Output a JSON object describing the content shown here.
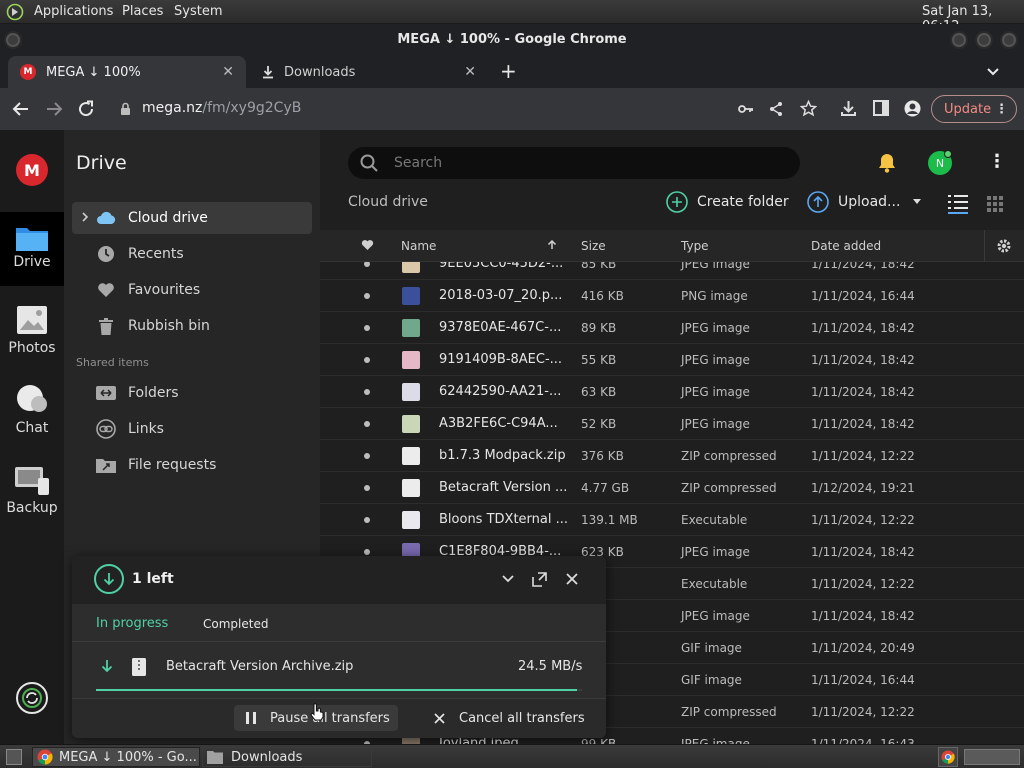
{
  "panel": {
    "applications": "Applications",
    "places": "Places",
    "system": "System",
    "clock": "Sat Jan 13, 06:12"
  },
  "window": {
    "title": "MEGA ↓ 100% - Google Chrome"
  },
  "tabs": [
    {
      "label": "MEGA ↓ 100%",
      "close": "✕"
    },
    {
      "label": "Downloads",
      "close": "✕"
    }
  ],
  "toolbar": {
    "url_host": "mega.nz",
    "url_path": "/fm/xy9g2CyB",
    "update_label": "Update"
  },
  "rail": {
    "items": [
      {
        "label": "Drive"
      },
      {
        "label": "Photos"
      },
      {
        "label": "Chat"
      },
      {
        "label": "Backup"
      }
    ]
  },
  "sidebar": {
    "title": "Drive",
    "items": [
      {
        "label": "Cloud drive"
      },
      {
        "label": "Recents"
      },
      {
        "label": "Favourites"
      },
      {
        "label": "Rubbish bin"
      }
    ],
    "shared_header": "Shared items",
    "shared": [
      {
        "label": "Folders"
      },
      {
        "label": "Links"
      },
      {
        "label": "File requests"
      }
    ]
  },
  "main": {
    "search_placeholder": "Search",
    "avatar": "N",
    "breadcrumb": "Cloud drive",
    "create_folder": "Create folder",
    "upload": "Upload...",
    "columns": {
      "name": "Name",
      "size": "Size",
      "type": "Type",
      "date": "Date added"
    },
    "rows": [
      {
        "name": "9ΕE05CC0-45D2-...",
        "size": "85 KB",
        "type": "JPEG image",
        "date": "1/11/2024, 18:42",
        "color": "#d9c9a8"
      },
      {
        "name": "2018-03-07_20.p...",
        "size": "416 KB",
        "type": "PNG image",
        "date": "1/11/2024, 16:44",
        "color": "#3c4f9a"
      },
      {
        "name": "9378E0AE-467C-...",
        "size": "89 KB",
        "type": "JPEG image",
        "date": "1/11/2024, 18:42",
        "color": "#6fa88a"
      },
      {
        "name": "9191409B-8AEC-...",
        "size": "55 KB",
        "type": "JPEG image",
        "date": "1/11/2024, 18:42",
        "color": "#e5b8c8"
      },
      {
        "name": "62442590-AA21-...",
        "size": "63 KB",
        "type": "JPEG image",
        "date": "1/11/2024, 18:42",
        "color": "#dcdce8"
      },
      {
        "name": "A3B2FE6C-C94A...",
        "size": "52 KB",
        "type": "JPEG image",
        "date": "1/11/2024, 18:42",
        "color": "#c9d7b8"
      },
      {
        "name": "b1.7.3 Modpack.zip",
        "size": "376 KB",
        "type": "ZIP compressed",
        "date": "1/11/2024, 12:22",
        "color": "#ececec"
      },
      {
        "name": "Betacraft Version ...",
        "size": "4.77 GB",
        "type": "ZIP compressed",
        "date": "1/12/2024, 19:21",
        "color": "#ececec"
      },
      {
        "name": "Bloons TDXternal ...",
        "size": "139.1 MB",
        "type": "Executable",
        "date": "1/11/2024, 12:22",
        "color": "#e8e8ee"
      },
      {
        "name": "C1E8F804-9BB4-...",
        "size": "623 KB",
        "type": "JPEG image",
        "date": "1/11/2024, 18:42",
        "color": "#7a6ab0"
      },
      {
        "name": "",
        "size": "MB",
        "type": "Executable",
        "date": "1/11/2024, 12:22",
        "color": "#e8e8ee"
      },
      {
        "name": "",
        "size": "B",
        "type": "JPEG image",
        "date": "1/11/2024, 18:42",
        "color": "#cccccc"
      },
      {
        "name": "",
        "size": "KB",
        "type": "GIF image",
        "date": "1/11/2024, 20:49",
        "color": "#aaaaaa"
      },
      {
        "name": "",
        "size": "MB",
        "type": "GIF image",
        "date": "1/11/2024, 16:44",
        "color": "#aaaaaa"
      },
      {
        "name": "",
        "size": "B",
        "type": "ZIP compressed",
        "date": "1/11/2024, 12:22",
        "color": "#ececec"
      },
      {
        "name": "Joyland.jpeg",
        "size": "99 KB",
        "type": "JPEG image",
        "date": "1/11/2024, 16:43",
        "color": "#8a7a6a"
      }
    ]
  },
  "transfers": {
    "count_label": "1 left",
    "tab_in_progress": "In progress",
    "tab_completed": "Completed",
    "file_name": "Betacraft Version Archive.zip",
    "speed": "24.5 MB/s",
    "progress": 0.99,
    "pause_all": "Pause all transfers",
    "cancel_all": "Cancel all transfers"
  },
  "taskbar": {
    "items": [
      {
        "label": "MEGA ↓ 100% - Go..."
      },
      {
        "label": "Downloads"
      }
    ]
  }
}
